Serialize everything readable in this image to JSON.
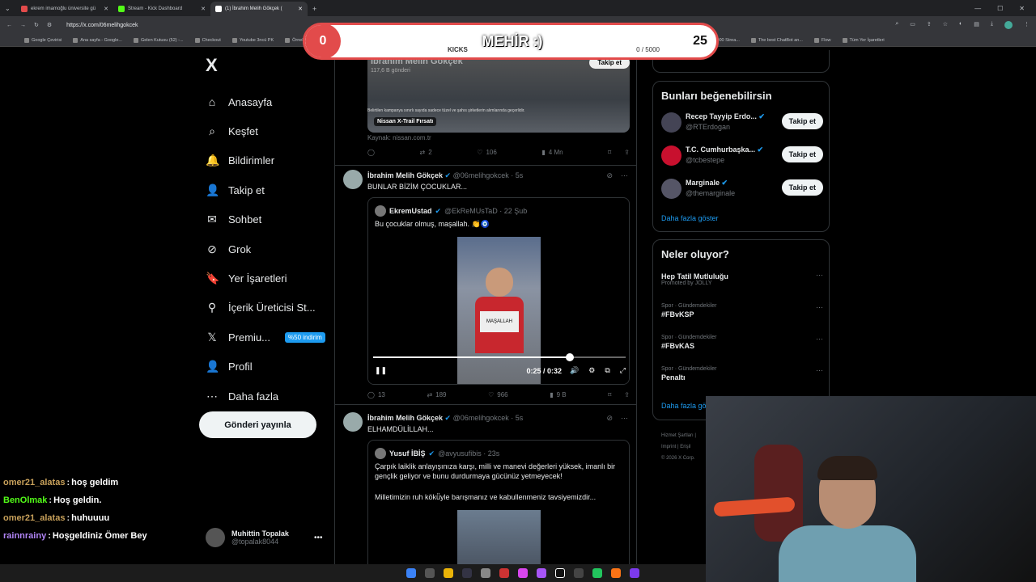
{
  "browser": {
    "tabs": [
      {
        "label": "ekrem imamoğlu üniversite gü",
        "color": "#e24b4b"
      },
      {
        "label": "Stream - Kick Dashboard",
        "color": "#53fc18"
      },
      {
        "label": "(1) İbrahim Melih Gökçek (",
        "color": "#ffffff"
      }
    ],
    "url": "https://x.com/06melihgokcek",
    "bookmarks": [
      "Google Çevirisi",
      "Ana sayfa - Google...",
      "Gelen Kutusu (52) -...",
      "Checkout",
      "Youtube 3ncü PK",
      "Örnek",
      "Transcript of \"Mi M...",
      "CapCut | Text to sp...",
      "Tube Thumbnail...",
      "Resize and reduce i...",
      "İspanyolca Ön...",
      "HeyGen - Projects",
      "BURÇ",
      "Esperanza000 Strea...",
      "The best ChatBot an...",
      "Flow",
      "Tüm Yer İşaretleri"
    ]
  },
  "overlay": {
    "left_count": "0",
    "title": "MEHİR :)",
    "label": "KICKS",
    "progress_text": "0  / 5000",
    "right_count": "25",
    "accent": "#e24b4b"
  },
  "nav": {
    "logo": "X",
    "items": [
      {
        "label": "Anasayfa",
        "icon": "⌂"
      },
      {
        "label": "Keşfet",
        "icon": "⌕"
      },
      {
        "label": "Bildirimler",
        "icon": "🔔"
      },
      {
        "label": "Takip et",
        "icon": "👤"
      },
      {
        "label": "Sohbet",
        "icon": "✉"
      },
      {
        "label": "Grok",
        "icon": "⊘"
      },
      {
        "label": "Yer İşaretleri",
        "icon": "🔖"
      },
      {
        "label": "İçerik Üreticisi St...",
        "icon": "⚲"
      },
      {
        "label": "Premiu...",
        "icon": "𝕏"
      },
      {
        "label": "Profil",
        "icon": "👤"
      },
      {
        "label": "Daha fazla",
        "icon": "⋯"
      }
    ],
    "premium_badge": "%50 indirim",
    "post_button": "Gönderi yayınla",
    "profile_name": "Muhittin Topalak",
    "profile_handle": "@topalak8044"
  },
  "chat": [
    {
      "user": "omer21_alatas",
      "msg": "hoş geldim",
      "color": "#c7a05a"
    },
    {
      "user": "BenOlmak",
      "msg": "Hoş geldin.",
      "color": "#53fc18"
    },
    {
      "user": "omer21_alatas",
      "msg": "huhuuuu",
      "color": "#c7a05a"
    },
    {
      "user": "rainnrainy",
      "msg": "Hoşgeldiniz Ömer Bey",
      "color": "#b084f5"
    }
  ],
  "feed": {
    "top": {
      "author": "İbrahim Melih Gökçek",
      "subtitle": "117,6 B gönderi",
      "follow": "Takip et",
      "small_text": "Belirtilen kampanya sınırlı sayıda sadece tüzel ve şahıs şirketlerin alımlarında geçerlidir.",
      "caption": "Nissan X-Trail Fırsatı",
      "source": "Kaynak: nissan.com.tr",
      "stats": {
        "replies": "",
        "reposts": "2",
        "likes": "106",
        "views": "4 Mn"
      }
    },
    "tweet1": {
      "name": "İbrahim Melih Gökçek",
      "handle": "@06melihgokcek · 5s",
      "text": "BUNLAR BİZİM ÇOCUKLAR...",
      "quote_name": "EkremUstad",
      "quote_handle": "@EkReMUsTaD · 22 Şub",
      "quote_text": "Bu çocuklar olmuş, maşallah. 👏🧿",
      "sign_text": "MAŞALLAH",
      "time": "0:25 / 0:32",
      "progress": 0.78,
      "stats": {
        "replies": "13",
        "reposts": "189",
        "likes": "966",
        "views": "9 B"
      }
    },
    "tweet2": {
      "name": "İbrahim Melih Gökçek",
      "handle": "@06melihgokcek · 5s",
      "text": "ELHAMDÜLİLLAH...",
      "quote_name": "Yusuf İBİŞ",
      "quote_handle": "@avyusufibis · 23s",
      "quote_text_1": "Çarpık laiklik anlayışınıza karşı, milli ve manevi değerleri yüksek, imanlı bir gençlik geliyor ve bunu durdurmaya gücünüz yetmeyecek!",
      "quote_text_2": "Milletimizin ruh kökü̈yle barışmanız ve kabullenmeniz tavsiyemizdir..."
    }
  },
  "right": {
    "suggest_title": "Bunları beğenebilirsin",
    "suggestions": [
      {
        "name": "Recep Tayyip Erdo...",
        "handle": "@RTErdogan",
        "follow": "Takip et",
        "color": "#445"
      },
      {
        "name": "T.C. Cumhurbaşka...",
        "handle": "@tcbestepe",
        "follow": "Takip et",
        "color": "#c8102e"
      },
      {
        "name": "Marginale",
        "handle": "@themarginale",
        "follow": "Takip et",
        "color": "#556"
      }
    ],
    "show_more": "Daha fazla göster",
    "trends_title": "Neler oluyor?",
    "trends": [
      {
        "category": "",
        "name": "Hep Tatil Mutluluğu",
        "sub": "Promoted by JOLLY"
      },
      {
        "category": "Spor · Gündemdekiler",
        "name": "#FBvKSP",
        "sub": ""
      },
      {
        "category": "Spor · Gündemdekiler",
        "name": "#FBvKAS",
        "sub": ""
      },
      {
        "category": "Spor · Gündemdekiler",
        "name": "Penaltı",
        "sub": ""
      }
    ],
    "trends_more": "Daha fazla gö",
    "footer_1": "Hizmet Şartları |",
    "footer_2": "Imprint  |  Erişil",
    "footer_3": "© 2026 X Corp."
  }
}
